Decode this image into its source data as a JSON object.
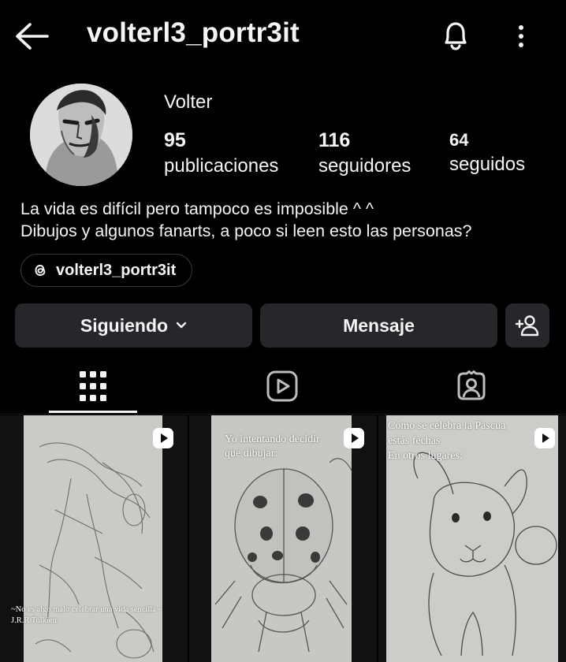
{
  "header": {
    "username": "volterl3_portr3it",
    "back_icon": "arrow-left-icon",
    "notifications_icon": "bell-icon",
    "more_icon": "more-vertical-icon"
  },
  "profile": {
    "display_name": "Volter",
    "stats": [
      {
        "count": "95",
        "label": "publicaciones"
      },
      {
        "count": "116",
        "label": "seguidores"
      },
      {
        "count": "64",
        "label": "seguidos"
      }
    ],
    "bio": [
      "La vida es difícil pero tampoco es imposible ^ ^",
      "Dibujos y algunos fanarts, a poco si leen esto las personas?"
    ],
    "threads_handle": "volterl3_portr3it"
  },
  "actions": {
    "following_label": "Siguiendo",
    "message_label": "Mensaje",
    "add_user_icon": "add-user-icon"
  },
  "tabs": [
    {
      "icon": "grid-icon",
      "active": true
    },
    {
      "icon": "reels-icon",
      "active": false
    },
    {
      "icon": "tagged-icon",
      "active": false
    }
  ],
  "posts": [
    {
      "caption_line1": "~No es algo malo celebrar una vida sencilla~",
      "caption_line2": "J.R.R Tolkien",
      "type": "reel"
    },
    {
      "caption_line1": "Yo intentando decidir",
      "caption_line2": "que dibujar:",
      "type": "reel"
    },
    {
      "caption_line1": "Cómo se celebra la Pascua",
      "caption_line2": "estás fechas",
      "caption_line3": "En otros lugares:",
      "type": "reel"
    }
  ],
  "colors": {
    "background": "#000000",
    "button_bg": "#26272b",
    "text": "#f5f5f5"
  }
}
